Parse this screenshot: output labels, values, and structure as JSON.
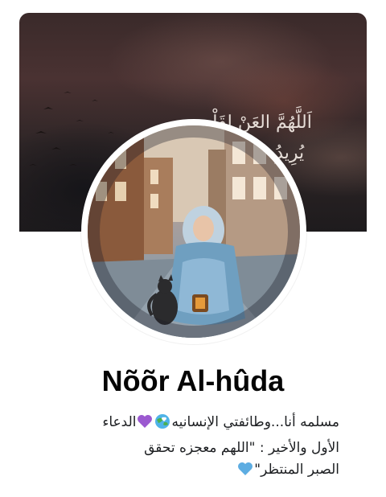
{
  "cover": {
    "verse_line1": "اَللَّهُمَّ العَنْ لِقَلْب",
    "verse_line2": "يُرِيدُ ... عَنْكَ \""
  },
  "profile": {
    "name": "Nõõr Al-hûda",
    "bio": {
      "line1_text_a": "مسلمه أنا...وطائفتي الإنسانيه",
      "line1_text_b": "الدعاء",
      "line2_text": "الأول والأخير :           \"اللهم معجزه تحقق",
      "line3_text": "الصبر المنتظر\""
    }
  },
  "emojis": {
    "globe": "globe-with-heart-icon",
    "purple_heart": "purple-heart-icon",
    "blue_heart": "blue-heart-icon"
  },
  "colors": {
    "name": "#050505",
    "bio": "#1c1e21",
    "purple_heart": "#9b59d0",
    "blue_heart": "#5dade2"
  }
}
